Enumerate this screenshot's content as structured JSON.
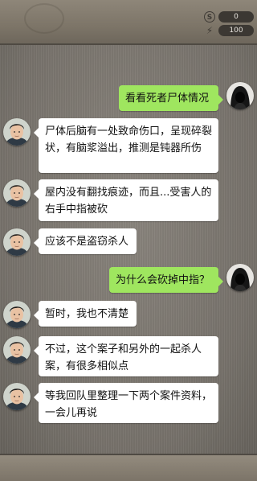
{
  "status": {
    "coins": "0",
    "energy": "100"
  },
  "messages": [
    {
      "side": "right",
      "avatar": "hooded-avatar-icon",
      "text": "看看死者尸体情况"
    },
    {
      "side": "left",
      "avatar": "detective-avatar",
      "text": "尸体后脑有一处致命伤口，呈现碎裂状，有脑浆溢出，推测是钝器所伤"
    },
    {
      "side": "left",
      "avatar": "detective-avatar",
      "text": "屋内没有翻找痕迹，而且...受害人的右手中指被砍"
    },
    {
      "side": "left",
      "avatar": "detective-avatar",
      "text": "应该不是盗窃杀人"
    },
    {
      "side": "right",
      "avatar": "hooded-avatar-icon",
      "text": "为什么会砍掉中指？"
    },
    {
      "side": "left",
      "avatar": "detective-avatar",
      "text": "暂时，我也不清楚"
    },
    {
      "side": "left",
      "avatar": "detective-avatar",
      "text": "不过，这个案子和另外的一起杀人案，有很多相似点"
    },
    {
      "side": "left",
      "avatar": "detective-avatar",
      "text": "等我回队里整理一下两个案件资料，一会儿再说"
    }
  ]
}
